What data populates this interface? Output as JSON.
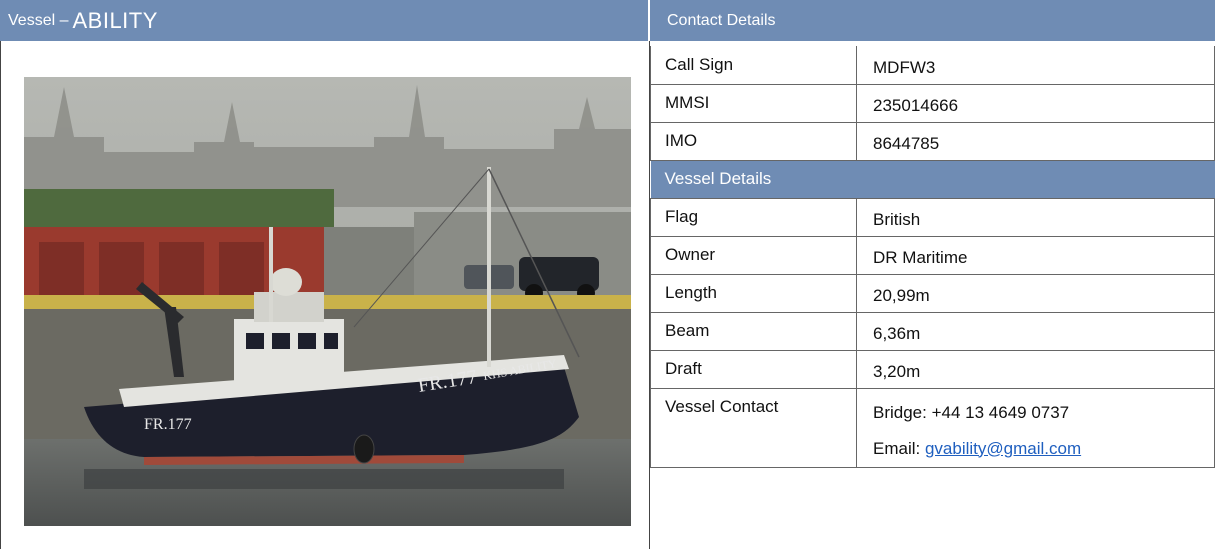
{
  "header": {
    "vessel_prefix": "Vessel –",
    "vessel_name": "ABILITY",
    "contact_title": "Contact Details"
  },
  "contact": {
    "call_sign_label": "Call Sign",
    "call_sign_value": "MDFW3",
    "mmsi_label": "MMSI",
    "mmsi_value": "235014666",
    "imo_label": "IMO",
    "imo_value": "8644785"
  },
  "vessel_details": {
    "title": "Vessel Details",
    "flag_label": "Flag",
    "flag_value": "British",
    "owner_label": "Owner",
    "owner_value": "DR Maritime",
    "length_label": "Length",
    "length_value": "20,99m",
    "beam_label": "Beam",
    "beam_value": "6,36m",
    "draft_label": "Draft",
    "draft_value": "3,20m",
    "vessel_contact_label": "Vessel Contact",
    "bridge_phone": "Bridge: +44 13 4649 0737",
    "email_prefix": "Email:",
    "email": "gvability@gmail.com"
  },
  "photo": {
    "hull_marking": "FR.177",
    "hull_name": "KHS ABILITY",
    "colors": {
      "sky": "#a9aba6",
      "hull": "#1d1f2c",
      "superstructure": "#e4e4e0",
      "shed_red": "#9a3a2e",
      "shed_roof": "#4f6a3e",
      "header_blue": "#6f8cb4"
    }
  }
}
